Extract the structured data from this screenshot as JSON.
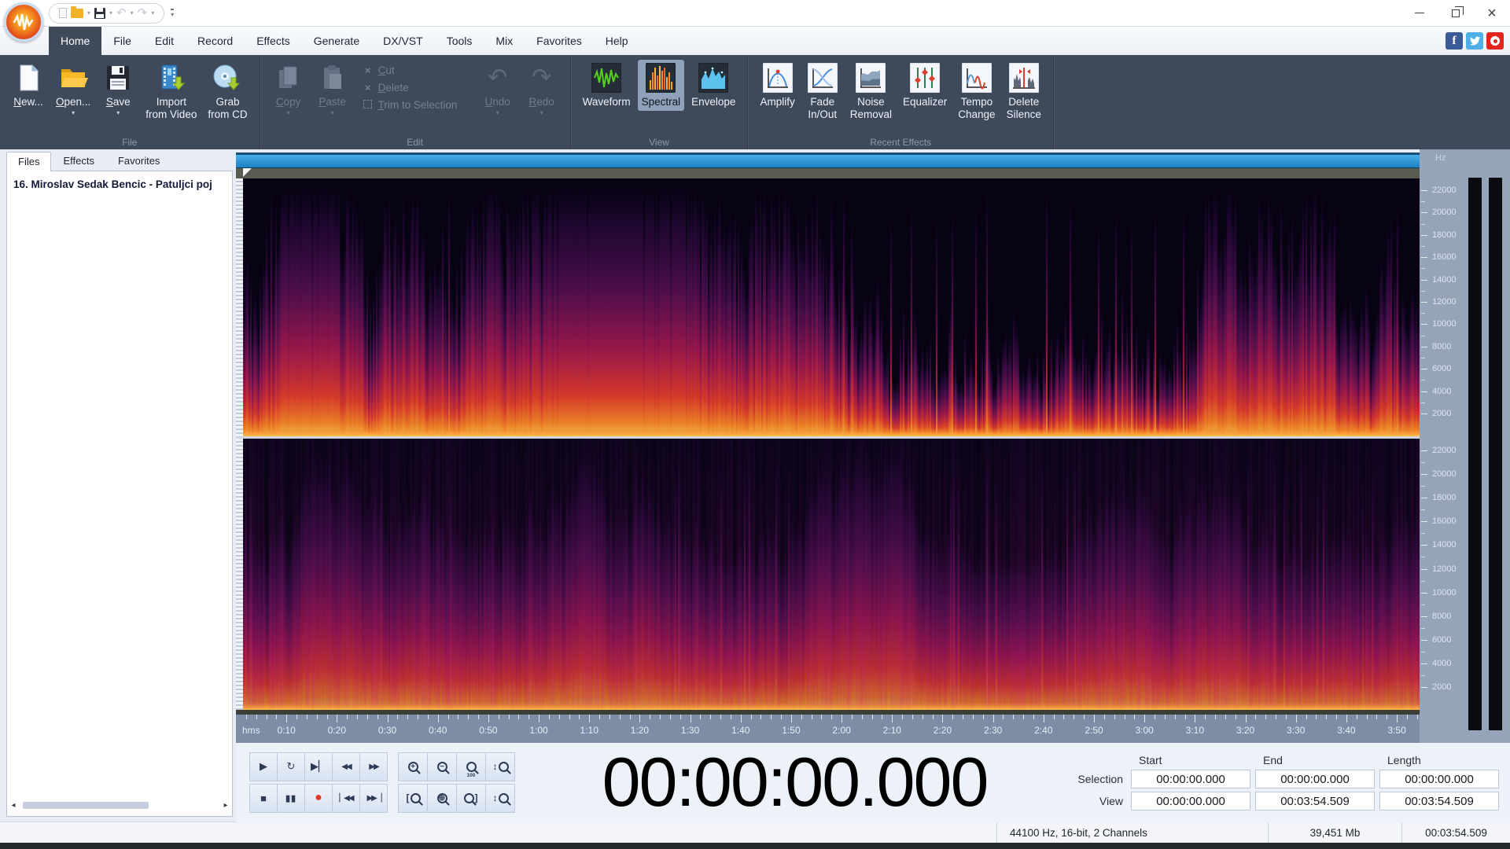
{
  "menu": {
    "tabs": [
      "Home",
      "File",
      "Edit",
      "Record",
      "Effects",
      "Generate",
      "DX/VST",
      "Tools",
      "Mix",
      "Favorites",
      "Help"
    ],
    "active": "Home"
  },
  "social_icons": [
    "facebook-icon",
    "twitter-icon",
    "youtube-icon"
  ],
  "qat_icons": [
    "new-document-icon",
    "open-folder-icon",
    "save-icon",
    "undo-icon",
    "redo-icon",
    "customize-toolbar-icon"
  ],
  "ribbon": {
    "groups": [
      {
        "label": "File",
        "items": [
          {
            "type": "big",
            "label": "New...",
            "accel": true,
            "icon": "new-file"
          },
          {
            "type": "big",
            "label": "Open...",
            "accel": true,
            "icon": "open-folder",
            "dropdown": true
          },
          {
            "type": "big",
            "label": "Save",
            "accel": true,
            "icon": "save",
            "dropdown": true
          },
          {
            "type": "big",
            "label": "Import\nfrom Video",
            "icon": "import-video"
          },
          {
            "type": "big",
            "label": "Grab\nfrom CD",
            "icon": "grab-cd"
          }
        ]
      },
      {
        "label": "Edit",
        "items": [
          {
            "type": "big",
            "label": "Copy",
            "accel": true,
            "icon": "copy",
            "dropdown": true,
            "disabled": true
          },
          {
            "type": "big",
            "label": "Paste",
            "accel": true,
            "icon": "paste",
            "dropdown": true,
            "disabled": true
          },
          {
            "type": "column",
            "items": [
              {
                "label": "Cut",
                "accel": true,
                "icon": "cut",
                "disabled": true
              },
              {
                "label": "Delete",
                "accel": true,
                "icon": "delete",
                "disabled": true
              },
              {
                "label": "Trim to Selection",
                "accel": true,
                "icon": "trim",
                "disabled": true
              }
            ]
          },
          {
            "type": "big",
            "label": "Undo",
            "accel": true,
            "icon": "undo",
            "dropdown": true,
            "disabled": true
          },
          {
            "type": "big",
            "label": "Redo",
            "accel": true,
            "icon": "redo",
            "dropdown": true,
            "disabled": true
          }
        ]
      },
      {
        "label": "View",
        "items": [
          {
            "type": "big",
            "label": "Waveform",
            "icon": "waveform"
          },
          {
            "type": "big",
            "label": "Spectral",
            "icon": "spectral",
            "active": true
          },
          {
            "type": "big",
            "label": "Envelope",
            "icon": "envelope"
          }
        ]
      },
      {
        "label": "Recent Effects",
        "items": [
          {
            "type": "big",
            "label": "Amplify",
            "icon": "amplify"
          },
          {
            "type": "big",
            "label": "Fade\nIn/Out",
            "icon": "fade"
          },
          {
            "type": "big",
            "label": "Noise\nRemoval",
            "icon": "noise"
          },
          {
            "type": "big",
            "label": "Equalizer",
            "icon": "equalizer"
          },
          {
            "type": "big",
            "label": "Tempo\nChange",
            "icon": "tempo"
          },
          {
            "type": "big",
            "label": "Delete\nSilence",
            "icon": "silence"
          }
        ]
      }
    ]
  },
  "sidebar": {
    "tabs": [
      "Files",
      "Effects",
      "Favorites"
    ],
    "active": "Files",
    "files": [
      "16. Miroslav Sedak Bencic - Patuljci poj"
    ]
  },
  "spectral": {
    "freq_unit": "Hz",
    "freq_labels": [
      "22000",
      "20000",
      "18000",
      "16000",
      "14000",
      "12000",
      "10000",
      "8000",
      "6000",
      "4000",
      "2000"
    ],
    "ruler": {
      "unit": "hms",
      "duration_seconds": 234.509,
      "labels": [
        "0:10",
        "0:20",
        "0:30",
        "0:40",
        "0:50",
        "1:00",
        "1:10",
        "1:20",
        "1:30",
        "1:40",
        "1:50",
        "2:00",
        "2:10",
        "2:20",
        "2:30",
        "2:40",
        "2:50",
        "3:00",
        "3:10",
        "3:20",
        "3:30",
        "3:40",
        "3:50"
      ]
    },
    "palette": {
      "background": "#070312",
      "low": "#ffd25a",
      "mid": "#f0402e",
      "high": "#6a1575"
    }
  },
  "transport": {
    "rows": [
      [
        {
          "name": "play-button",
          "icon": "play"
        },
        {
          "name": "loop-button",
          "icon": "loop"
        },
        {
          "name": "play-to-end-button",
          "icon": "play-end"
        },
        {
          "name": "rewind-button",
          "icon": "rewind"
        },
        {
          "name": "fast-forward-button",
          "icon": "forward"
        }
      ],
      [
        {
          "name": "stop-button",
          "icon": "stop"
        },
        {
          "name": "pause-button",
          "icon": "pause"
        },
        {
          "name": "record-button",
          "icon": "record"
        },
        {
          "name": "go-to-start-button",
          "icon": "to-start"
        },
        {
          "name": "go-to-end-button",
          "icon": "to-end"
        }
      ]
    ]
  },
  "zoom_controls": {
    "rows": [
      [
        {
          "name": "zoom-in-button",
          "icon": "zoom-in"
        },
        {
          "name": "zoom-out-button",
          "icon": "zoom-out"
        },
        {
          "name": "zoom-100-button",
          "icon": "zoom-100"
        },
        {
          "name": "zoom-vertical-button",
          "icon": "zoom-vert"
        }
      ],
      [
        {
          "name": "zoom-selection-start-button",
          "icon": "zoom-sel-start"
        },
        {
          "name": "zoom-selection-button",
          "icon": "zoom-sel"
        },
        {
          "name": "zoom-selection-end-button",
          "icon": "zoom-sel-end"
        },
        {
          "name": "zoom-vertical-out-button",
          "icon": "zoom-vert"
        }
      ]
    ]
  },
  "time_display": "00:00:00.000",
  "selection_grid": {
    "headers": [
      "Start",
      "End",
      "Length"
    ],
    "rows": [
      {
        "label": "Selection",
        "values": [
          "00:00:00.000",
          "00:00:00.000",
          "00:00:00.000"
        ]
      },
      {
        "label": "View",
        "values": [
          "00:00:00.000",
          "00:03:54.509",
          "00:03:54.509"
        ]
      }
    ]
  },
  "status_bar": {
    "format": "44100 Hz, 16-bit, 2 Channels",
    "size": "39,451 Mb",
    "length": "00:03:54.509"
  }
}
